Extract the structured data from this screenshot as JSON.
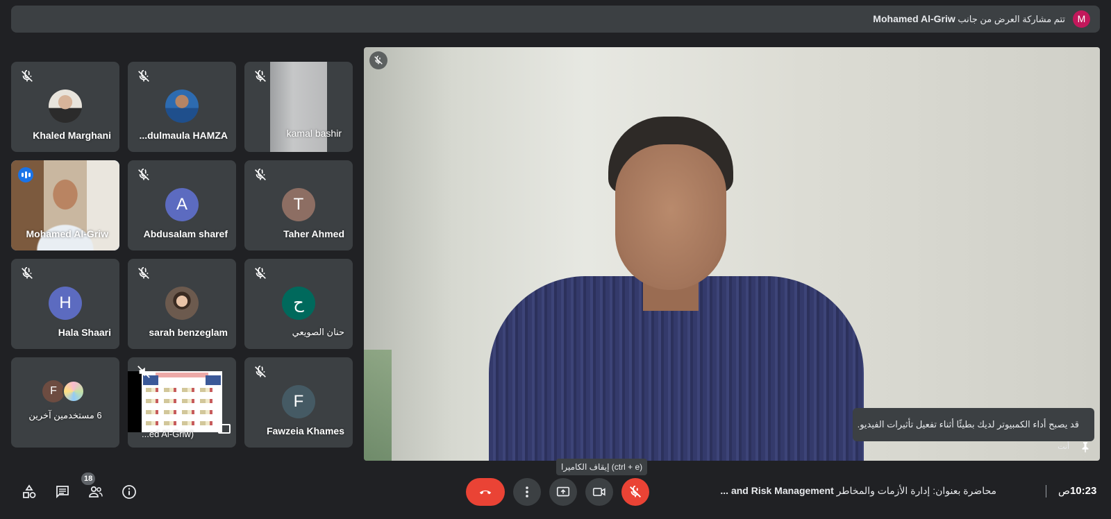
{
  "banner": {
    "avatar_letter": "M",
    "presenter": "Mohamed Al-Griw",
    "text": "تتم مشاركة العرض من جانب"
  },
  "tiles": [
    {
      "name": "Khaled Marghani",
      "muted": true,
      "avatar": "photo"
    },
    {
      "name": "...dulmaula HAMZA",
      "muted": true,
      "avatar": "photo"
    },
    {
      "name": "kamal bashir",
      "muted": true,
      "avatar": "video"
    },
    {
      "name": "Mohamed Al-Griw",
      "muted": false,
      "speaking": true,
      "avatar": "video"
    },
    {
      "name": "Abdusalam sharef",
      "muted": true,
      "initial": "A",
      "color": "#5c6bc0"
    },
    {
      "name": "Taher Ahmed",
      "muted": true,
      "initial": "T",
      "color": "#8d6e63"
    },
    {
      "name": "Hala Shaari",
      "muted": true,
      "initial": "H",
      "color": "#5c6bc0"
    },
    {
      "name": "sarah benzeglam",
      "muted": true,
      "avatar": "photo"
    },
    {
      "name": "حنان الصويعي",
      "muted": true,
      "initial": "ح",
      "color": "#00695c"
    },
    {
      "name": "6 مستخدمين آخرين",
      "initial": "F",
      "color": "#6d4c41"
    },
    {
      "name": "...ed Al-Griw)",
      "muted": true,
      "avatar": "presentation"
    },
    {
      "name": "Fawzeia Khames",
      "muted": true,
      "initial": "F",
      "color": "#455a64"
    }
  ],
  "main": {
    "toast": "قد يصبح أداء الكمبيوتر لديك بطيئًا أثناء تفعيل تأثيرات الفيديو.",
    "you_label": "أنت"
  },
  "tooltip": "إيقاف الكاميرا (ctrl + e)",
  "bottom": {
    "participants_count": "18",
    "meeting_title_ar": "محاضرة بعنوان: إدارة الأزمات والمخاطر",
    "meeting_title_en": "and Risk Management ...",
    "time": "10:23",
    "ampm": "ص"
  },
  "colors": {
    "red": "#ea4335",
    "control_bg": "#3c4043",
    "accent": "#8ab4f8"
  }
}
